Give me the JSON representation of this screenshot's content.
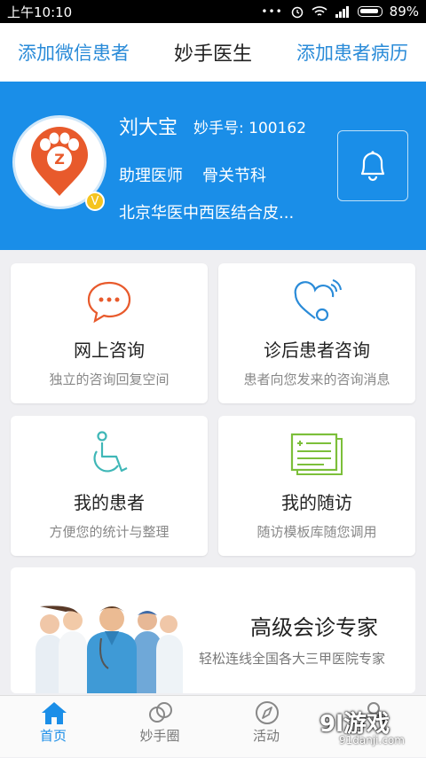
{
  "status_bar": {
    "time": "上午10:10",
    "dots": "•••",
    "battery": "89%"
  },
  "header": {
    "left_link": "添加微信患者",
    "title": "妙手医生",
    "right_link": "添加患者病历"
  },
  "profile": {
    "name": "刘大宝",
    "id_label": "妙手号: 100162",
    "role": "助理医师",
    "department": "骨关节科",
    "hospital": "北京华医中西医结合皮...",
    "badge": "V",
    "avatar_letter": "Z"
  },
  "cards": [
    {
      "title": "网上咨询",
      "subtitle": "独立的咨询回复空间",
      "icon": "chat-bubble-icon"
    },
    {
      "title": "诊后患者咨询",
      "subtitle": "患者向您发来的咨询消息",
      "icon": "heart-signal-icon"
    },
    {
      "title": "我的患者",
      "subtitle": "方便您的统计与整理",
      "icon": "wheelchair-icon"
    },
    {
      "title": "我的随访",
      "subtitle": "随访模板库随您调用",
      "icon": "medical-record-icon"
    }
  ],
  "banner": {
    "title": "高级会诊专家",
    "subtitle": "轻松连线全国各大三甲医院专家"
  },
  "bottom_nav": [
    {
      "label": "首页",
      "icon": "home-icon",
      "active": true
    },
    {
      "label": "妙手圈",
      "icon": "circles-icon",
      "active": false
    },
    {
      "label": "活动",
      "icon": "compass-icon",
      "active": false
    },
    {
      "label": "",
      "icon": "profile-icon",
      "active": false
    }
  ],
  "watermark": {
    "main": "9l游戏",
    "sub": "91danji.com"
  },
  "colors": {
    "primary": "#1a8ee8",
    "link": "#2a8bd8",
    "accent_orange": "#e85a2c",
    "accent_green": "#7cbf3a"
  }
}
